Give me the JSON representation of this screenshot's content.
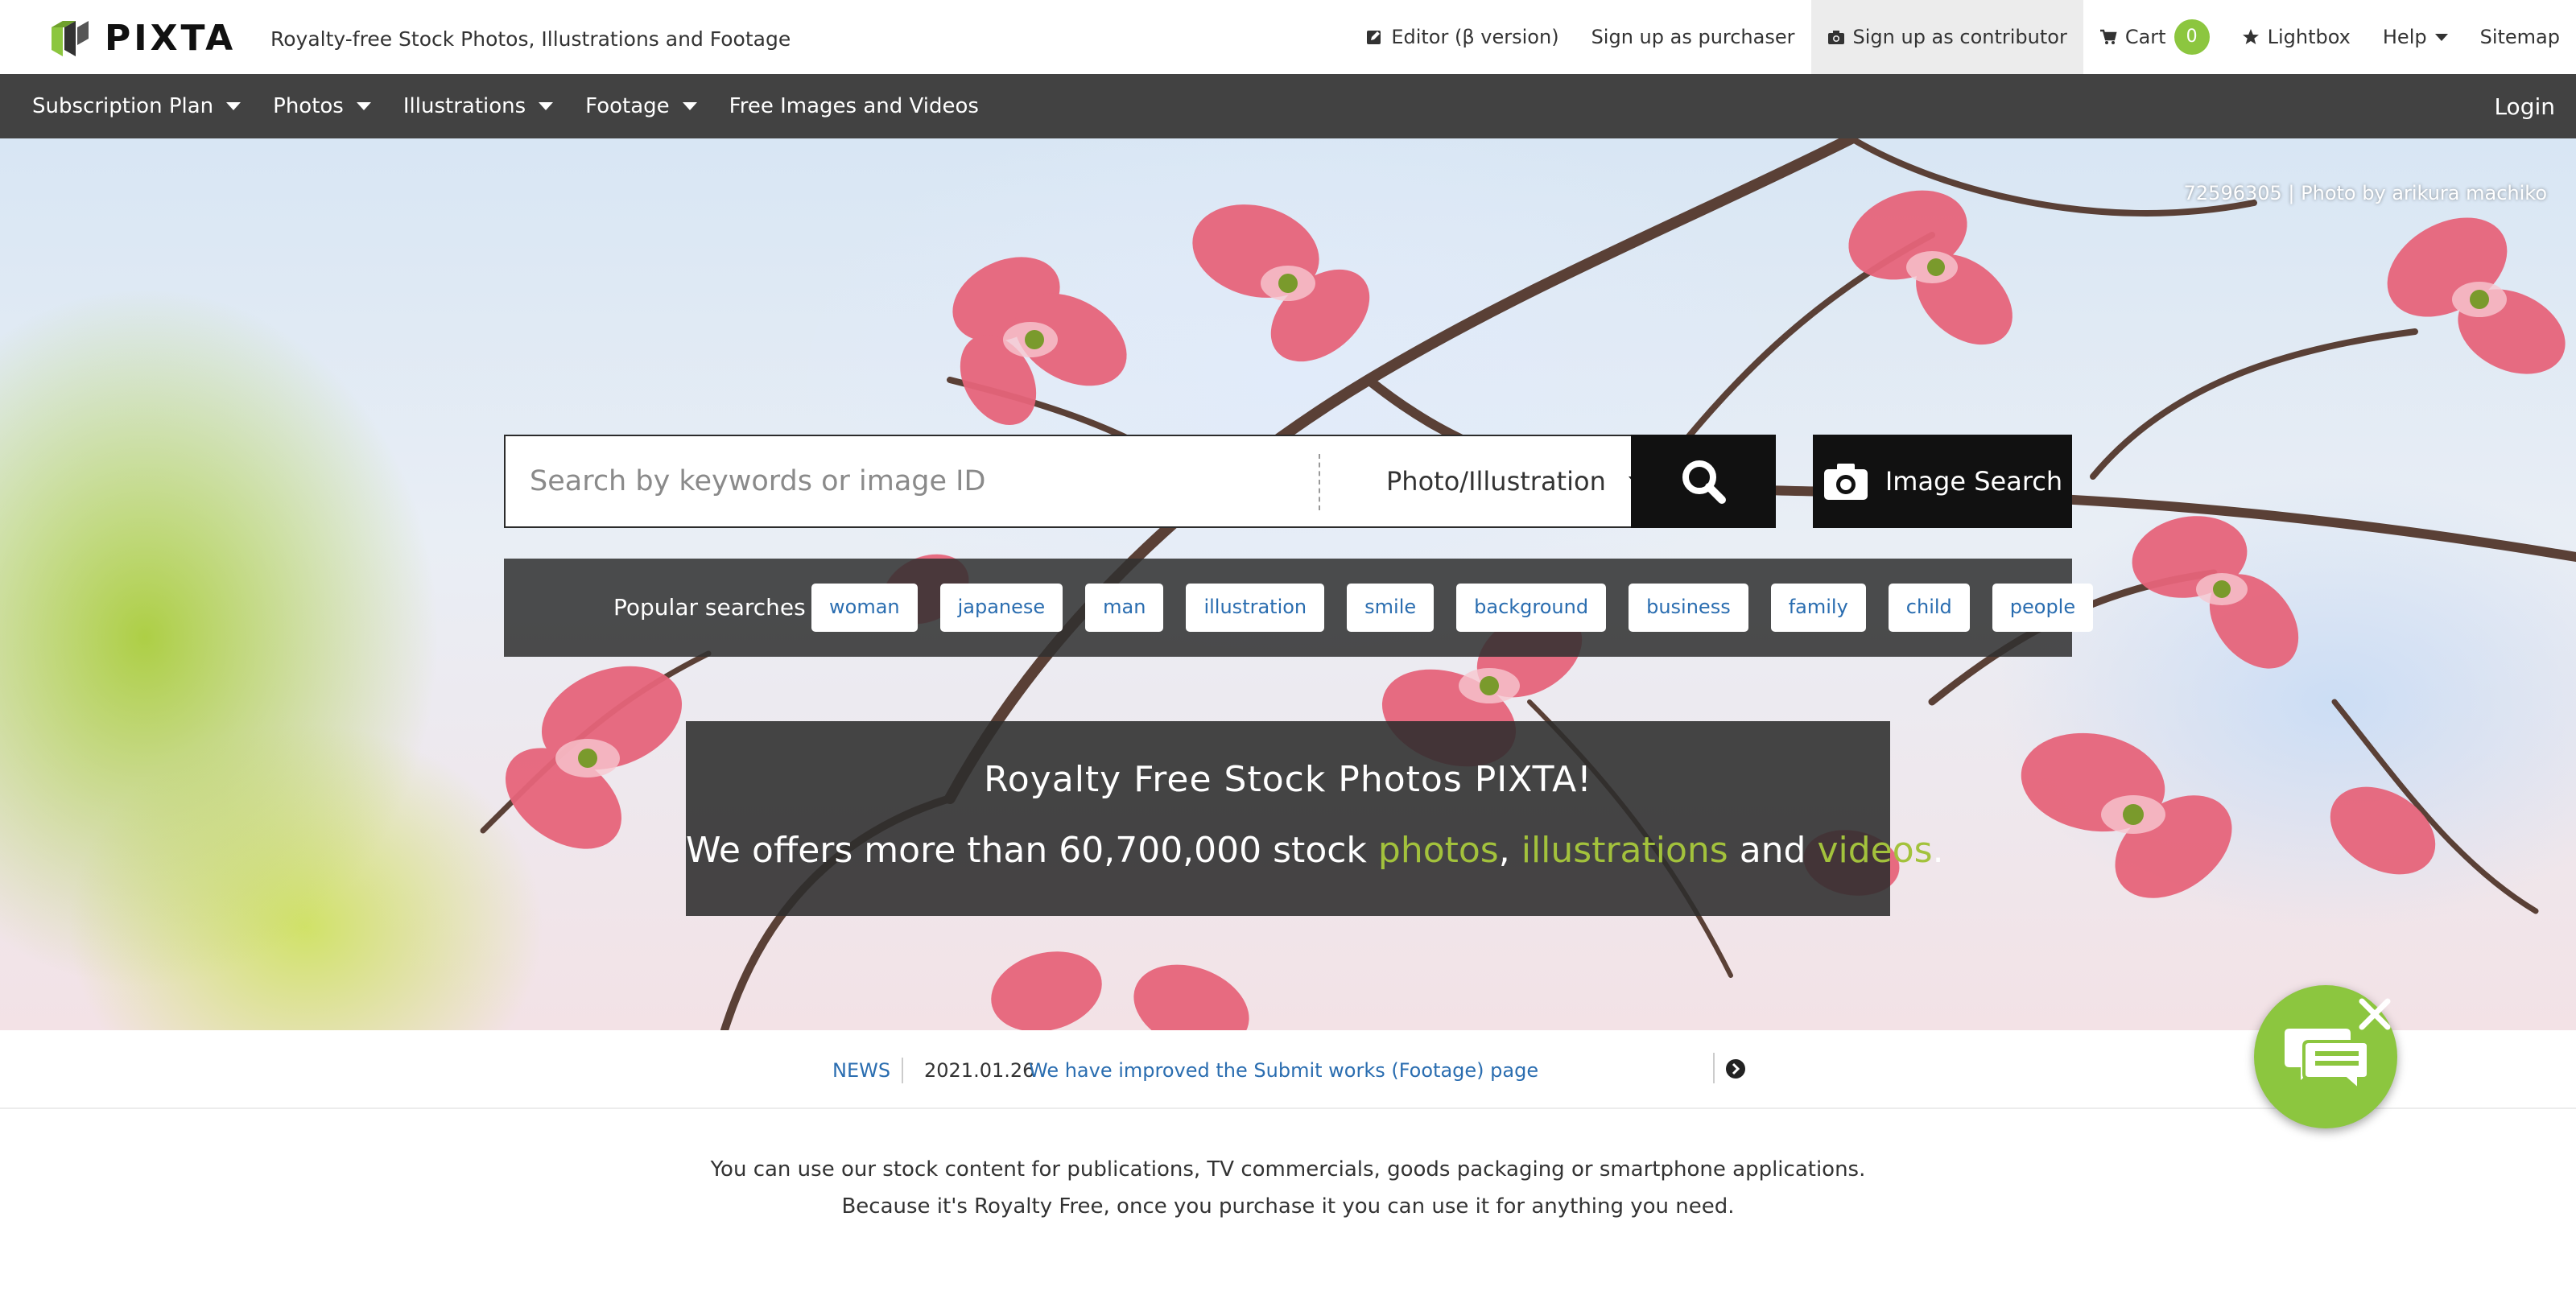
{
  "header": {
    "logo_text": "PIXTA",
    "tagline": "Royalty-free Stock Photos, Illustrations and Footage",
    "nav": {
      "editor": "Editor (β version)",
      "signup_purchaser": "Sign up as purchaser",
      "signup_contributor": "Sign up as contributor",
      "cart": "Cart",
      "cart_count": "0",
      "lightbox": "Lightbox",
      "help": "Help",
      "sitemap": "Sitemap"
    }
  },
  "mainnav": {
    "items": [
      {
        "label": "Subscription Plan"
      },
      {
        "label": "Photos"
      },
      {
        "label": "Illustrations"
      },
      {
        "label": "Footage"
      },
      {
        "label": "Free Images and Videos"
      }
    ],
    "login": "Login"
  },
  "hero": {
    "credit": "72596305 | Photo by arikura machiko",
    "search": {
      "placeholder": "Search by keywords or image ID",
      "type": "Photo/Illustration",
      "image_search": "Image Search"
    },
    "popular": {
      "label": "Popular searches :",
      "tags": [
        "woman",
        "japanese",
        "man",
        "illustration",
        "smile",
        "background",
        "business",
        "family",
        "child",
        "people"
      ]
    },
    "banner": {
      "title": "Royalty Free Stock Photos PIXTA!",
      "sub_prefix": "We offers more than 60,700,000 stock ",
      "photos": "photos",
      "comma": ", ",
      "illustrations": "illustrations",
      "and": " and ",
      "videos": "videos",
      "period": "."
    }
  },
  "news": {
    "label": "NEWS",
    "date": "2021.01.26",
    "headline": "We have improved the Submit works (Footage) page"
  },
  "info": {
    "line1": "You can use our stock content for publications, TV commercials, goods packaging or smartphone applications.",
    "line2": "Because it's Royalty Free, once you purchase it you can use it for anything you need."
  },
  "colors": {
    "accent_green": "#8cc63f",
    "link_blue": "#2a6db0",
    "nav_bg": "#424242",
    "highlight_text": "#a3c23c"
  },
  "icons": [
    "pixta-logo-icon",
    "edit-icon",
    "camera-icon",
    "cart-icon",
    "star-icon",
    "search-icon",
    "chevron-right-icon",
    "chat-icon",
    "close-icon"
  ]
}
